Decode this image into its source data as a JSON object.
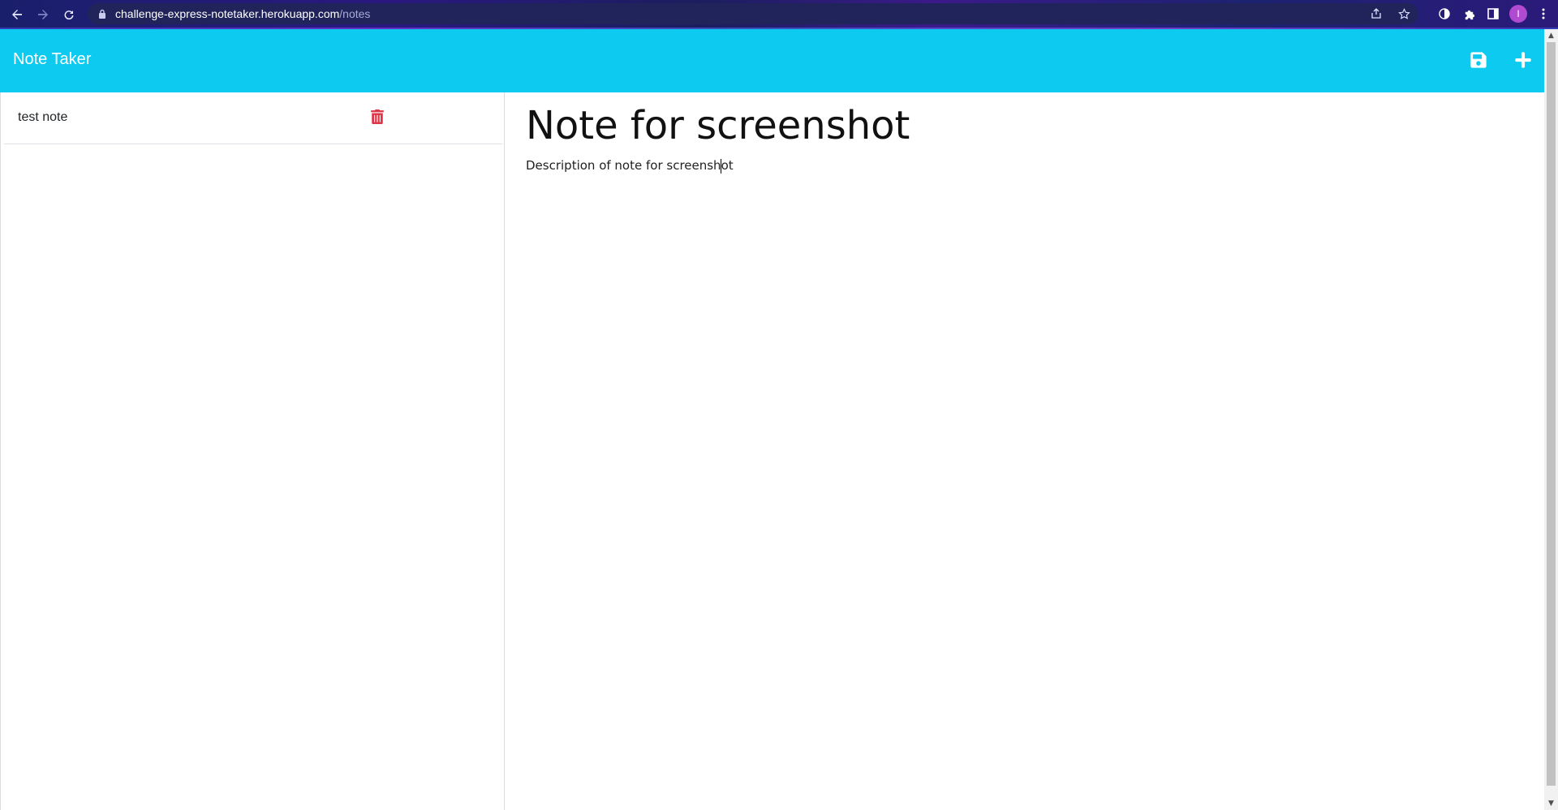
{
  "browser": {
    "url_host": "challenge-express-notetaker.herokuapp.com",
    "url_path": "/notes",
    "avatar_initial": "I",
    "icons": {
      "back": "arrow-left-icon",
      "forward": "arrow-right-icon",
      "reload": "reload-icon",
      "lock": "lock-icon",
      "share": "share-icon",
      "bookmark": "star-icon",
      "extension1": "circle-half-icon",
      "extensions": "puzzle-icon",
      "sidepanel": "side-panel-icon",
      "menu": "kebab-menu-icon"
    }
  },
  "header": {
    "brand": "Note Taker",
    "color": "#0dcaf0",
    "icons": {
      "save": "save-icon",
      "new": "plus-icon"
    }
  },
  "sidebar": {
    "notes": [
      {
        "title": "test note"
      }
    ],
    "delete_color": "#dc3545"
  },
  "editor": {
    "title_value": "Note for screenshot",
    "text_value": "Description of note for screenshot"
  }
}
